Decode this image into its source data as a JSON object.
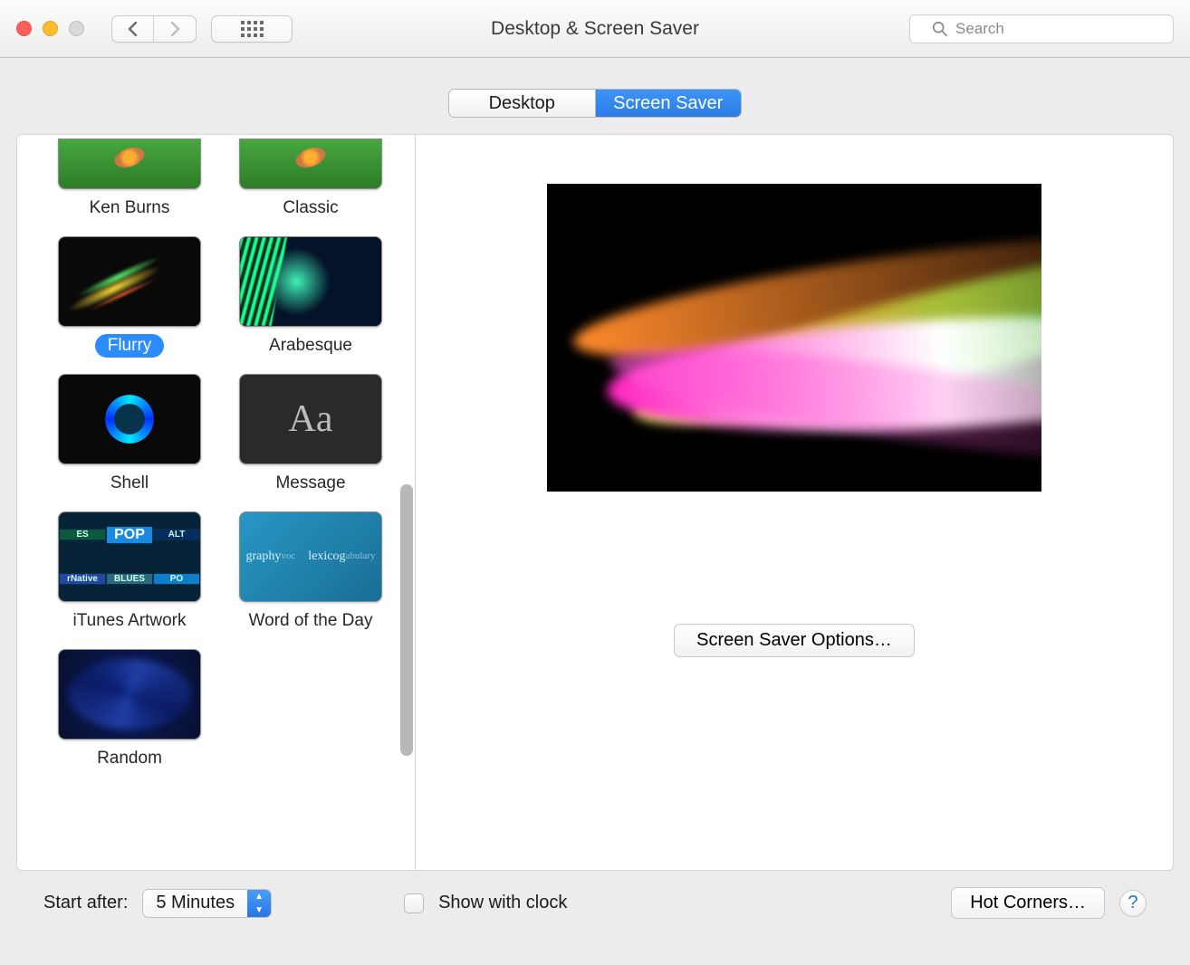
{
  "window": {
    "title": "Desktop & Screen Saver",
    "search_placeholder": "Search"
  },
  "tabs": {
    "desktop": "Desktop",
    "screen_saver": "Screen Saver",
    "active": "screen_saver"
  },
  "savers": [
    {
      "id": "ken-burns",
      "name": "Ken Burns",
      "partial": true
    },
    {
      "id": "classic",
      "name": "Classic",
      "partial": true
    },
    {
      "id": "flurry",
      "name": "Flurry",
      "selected": true
    },
    {
      "id": "arabesque",
      "name": "Arabesque"
    },
    {
      "id": "shell",
      "name": "Shell"
    },
    {
      "id": "message",
      "name": "Message"
    },
    {
      "id": "itunes",
      "name": "iTunes Artwork"
    },
    {
      "id": "wod",
      "name": "Word of the Day"
    },
    {
      "id": "random",
      "name": "Random"
    }
  ],
  "preview": {
    "options_button": "Screen Saver Options…"
  },
  "footer": {
    "start_after_label": "Start after:",
    "start_after_value": "5 Minutes",
    "show_clock_label": "Show with clock",
    "show_clock_checked": false,
    "hot_corners": "Hot Corners…",
    "help": "?"
  }
}
